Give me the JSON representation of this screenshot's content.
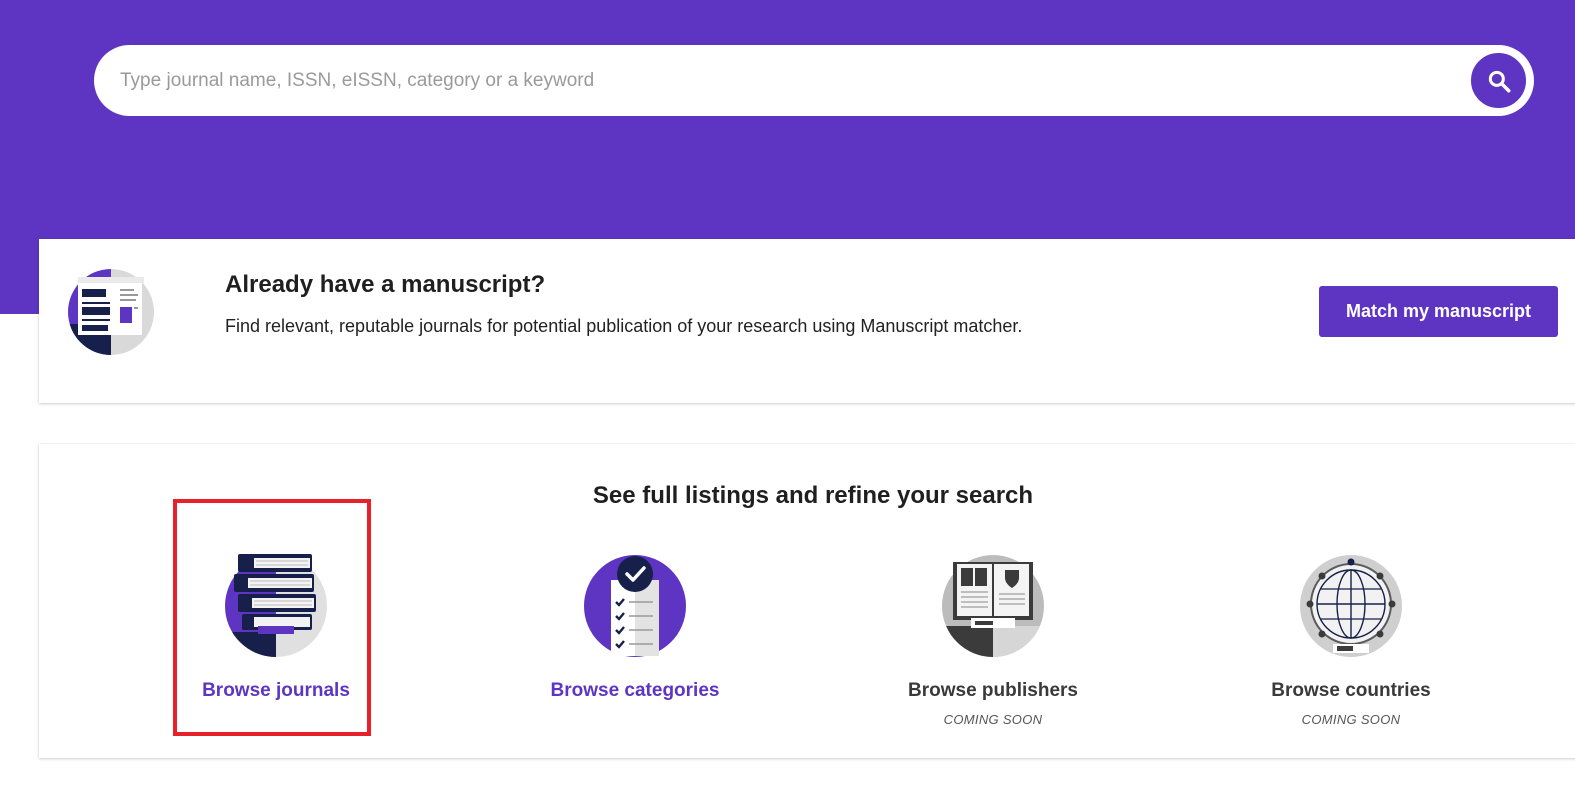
{
  "search": {
    "placeholder": "Type journal name, ISSN, eISSN, category or a keyword",
    "value": "",
    "button_icon": "search-icon"
  },
  "manuscript_card": {
    "icon": "manuscript-icon",
    "title": "Already have a manuscript?",
    "description": "Find relevant, reputable journals for potential publication of your research using Manuscript matcher.",
    "button_label": "Match my manuscript"
  },
  "browse": {
    "heading": "See full listings and refine your search",
    "items": [
      {
        "label": "Browse journals",
        "icon": "books-stack-icon",
        "subtitle": "",
        "active": true
      },
      {
        "label": "Browse categories",
        "icon": "checklist-icon",
        "subtitle": "",
        "active": true
      },
      {
        "label": "Browse publishers",
        "icon": "publisher-book-icon",
        "subtitle": "COMING SOON",
        "active": false
      },
      {
        "label": "Browse countries",
        "icon": "globe-icon",
        "subtitle": "COMING SOON",
        "active": false
      }
    ]
  },
  "colors": {
    "brand": "#5e35c2",
    "navy": "#16204a",
    "highlight": "#e8202a"
  }
}
